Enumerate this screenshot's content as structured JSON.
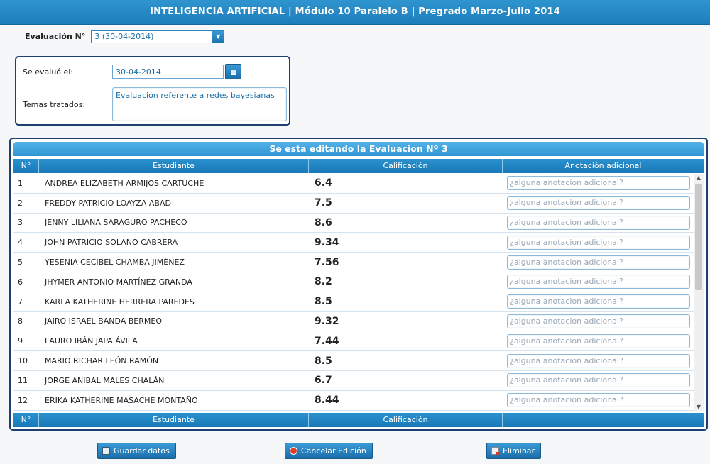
{
  "header": {
    "title": "INTELIGENCIA ARTIFICIAL | Módulo 10 Paralelo B | Pregrado Marzo-Julio 2014"
  },
  "evaluation": {
    "label": "Evaluación N°",
    "selected": "3 (30-04-2014)"
  },
  "info": {
    "date_label": "Se evaluó el:",
    "date_value": "30-04-2014",
    "topics_label": "Temas tratados:",
    "topics_value": "Evaluación referente a redes bayesianas"
  },
  "grid": {
    "caption": "Se esta editando la Evaluacion Nº 3",
    "columns": [
      "N°",
      "Estudiante",
      "Calificación",
      "Anotación adicional"
    ],
    "footer_columns": [
      "N°",
      "Estudiante",
      "Calificación",
      ""
    ],
    "note_placeholder": "¿alguna anotacion adicional?",
    "rows": [
      {
        "num": "1",
        "name": "ANDREA ELIZABETH ARMIJOS CARTUCHE",
        "grade": "6.4"
      },
      {
        "num": "2",
        "name": "FREDDY PATRICIO LOAYZA ABAD",
        "grade": "7.5"
      },
      {
        "num": "3",
        "name": "JENNY LILIANA SARAGURO PACHECO",
        "grade": "8.6"
      },
      {
        "num": "4",
        "name": "JOHN PATRICIO SOLANO CABRERA",
        "grade": "9.34"
      },
      {
        "num": "5",
        "name": "YESENIA CECIBEL CHAMBA JIMÉNEZ",
        "grade": "7.56"
      },
      {
        "num": "6",
        "name": "JHYMER ANTONIO MARTÍNEZ GRANDA",
        "grade": "8.2"
      },
      {
        "num": "7",
        "name": "KARLA KATHERINE HERRERA PAREDES",
        "grade": "8.5"
      },
      {
        "num": "8",
        "name": "JAIRO ISRAEL BANDA BERMEO",
        "grade": "9.32"
      },
      {
        "num": "9",
        "name": "LAURO IBÁN JAPA ÁVILA",
        "grade": "7.44"
      },
      {
        "num": "10",
        "name": "MARIO RICHAR LEÓN RAMÓN",
        "grade": "8.5"
      },
      {
        "num": "11",
        "name": "JORGE ANIBAL MALES CHALÁN",
        "grade": "6.7"
      },
      {
        "num": "12",
        "name": "ERIKA KATHERINE MASACHE MONTAÑO",
        "grade": "8.44"
      }
    ]
  },
  "actions": {
    "save": "Guardar datos",
    "cancel": "Cancelar Edición",
    "delete": "Eliminar"
  }
}
